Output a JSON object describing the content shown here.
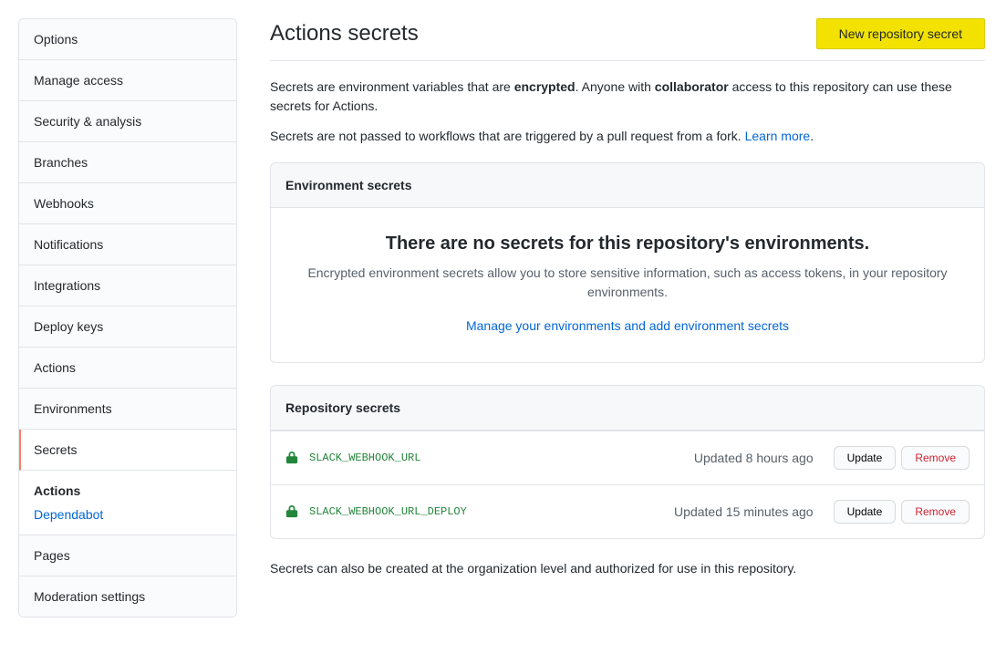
{
  "sidebar": {
    "items": [
      {
        "label": "Options"
      },
      {
        "label": "Manage access"
      },
      {
        "label": "Security & analysis"
      },
      {
        "label": "Branches"
      },
      {
        "label": "Webhooks"
      },
      {
        "label": "Notifications"
      },
      {
        "label": "Integrations"
      },
      {
        "label": "Deploy keys"
      },
      {
        "label": "Actions"
      },
      {
        "label": "Environments"
      },
      {
        "label": "Secrets"
      }
    ],
    "sub_header": "Actions",
    "sub_link": "Dependabot",
    "items_after": [
      {
        "label": "Pages"
      },
      {
        "label": "Moderation settings"
      }
    ]
  },
  "page": {
    "title": "Actions secrets",
    "new_button": "New repository secret",
    "intro1_prefix": "Secrets are environment variables that are ",
    "intro1_strong1": "encrypted",
    "intro1_mid": ". Anyone with ",
    "intro1_strong2": "collaborator",
    "intro1_suffix": " access to this repository can use these secrets for Actions.",
    "intro2_prefix": "Secrets are not passed to workflows that are triggered by a pull request from a fork. ",
    "intro2_link": "Learn more",
    "intro2_suffix": "."
  },
  "env_panel": {
    "header": "Environment secrets",
    "empty_title": "There are no secrets for this repository's environments.",
    "empty_desc": "Encrypted environment secrets allow you to store sensitive information, such as access tokens, in your repository environments.",
    "manage_link": "Manage your environments and add environment secrets"
  },
  "repo_panel": {
    "header": "Repository secrets",
    "update_label": "Update",
    "remove_label": "Remove",
    "secrets": [
      {
        "name": "SLACK_WEBHOOK_URL",
        "updated": "Updated 8 hours ago"
      },
      {
        "name": "SLACK_WEBHOOK_URL_DEPLOY",
        "updated": "Updated 15 minutes ago"
      }
    ]
  },
  "footer_note": "Secrets can also be created at the organization level and authorized for use in this repository."
}
